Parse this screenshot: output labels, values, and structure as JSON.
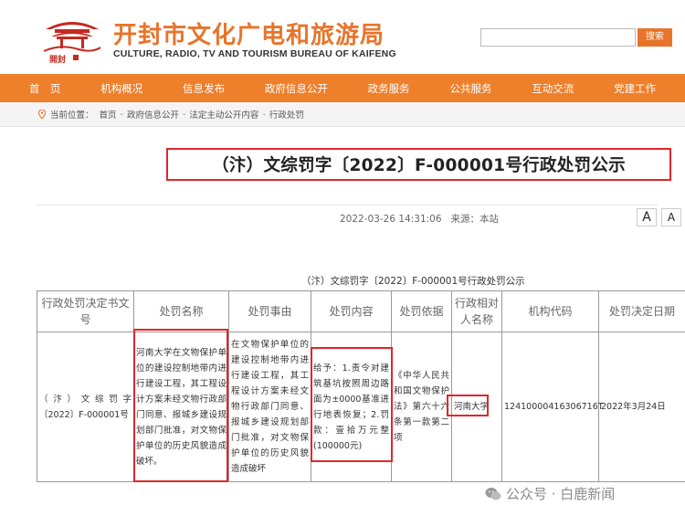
{
  "header": {
    "logo_text": "開封",
    "title": "开封市文化广电和旅游局",
    "subtitle": "CULTURE, RADIO, TV AND TOURISM BUREAU OF KAIFENG",
    "search": {
      "placeholder": "",
      "button_label": "搜索"
    }
  },
  "nav": [
    "首　页",
    "机构概况",
    "信息发布",
    "政府信息公开",
    "政务服务",
    "公共服务",
    "互动交流",
    "党建工作"
  ],
  "breadcrumb": {
    "prefix": "当前位置：",
    "items": [
      "首页",
      "政府信息公开",
      "法定主动公开内容",
      "行政处罚"
    ],
    "separator": "-"
  },
  "article": {
    "title": "（汴）文综罚字〔2022〕F-000001号行政处罚公示",
    "date": "2022-03-26 14:31:06",
    "source": "来源：本站",
    "font_large": "A",
    "font_small": "A"
  },
  "table": {
    "caption": "（汴）文综罚字〔2022〕F-000001号行政处罚公示",
    "headers": [
      "行政处罚决定书文号",
      "处罚名称",
      "处罚事由",
      "处罚内容",
      "处罚依据",
      "行政相对人名称",
      "机构代码",
      "处罚决定日期"
    ],
    "row": {
      "doc_no": "（ 汴 ） 文 综 罚 字〔2022〕F-000001号",
      "name": "河南大学在文物保护单位的建设控制地带内进行建设工程，其工程设计方案未经文物行政部门同意、报城乡建设规划部门批准，对文物保护单位的历史风貌造成破坏。",
      "reason": "在文物保护单位的建设控制地带内进行建设工程，其工程设计方案未经文物行政部门同意、报城乡建设规划部门批准，对文物保护单位的历史风貌造成破坏",
      "content": "给予：1.责令对建筑基坑按照周边路面为±0000基准进行地表恢复；2.罚款：壹拾万元整(100000元)",
      "basis": "《中华人民共和国文物保护法》第六十六条第一款第二项",
      "party": "河南大学",
      "org_code": "12410000416306716T",
      "date": "2022年3月24日"
    }
  },
  "watermark": "公众号 · 白鹿新闻",
  "colors": {
    "accent": "#ee7f2b",
    "highlight": "#e0262b"
  }
}
